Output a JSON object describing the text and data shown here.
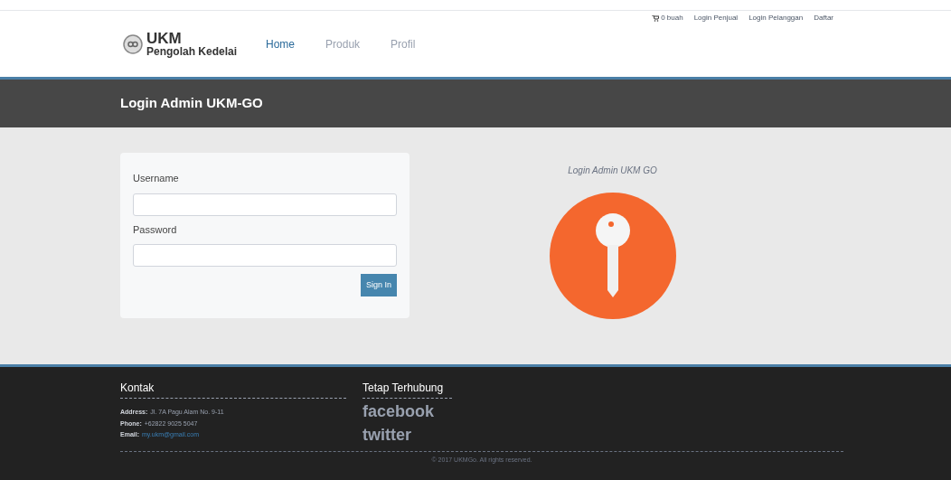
{
  "top_links": {
    "cart": "0 buah",
    "links": [
      "Login Penjual",
      "Login Pelanggan",
      "Daftar"
    ]
  },
  "brand": {
    "title": "UKM",
    "subtitle": "Pengolah Kedelai"
  },
  "nav": [
    {
      "label": "Home",
      "selected": true
    },
    {
      "label": "Produk",
      "selected": false
    },
    {
      "label": "Profil",
      "selected": false
    }
  ],
  "page_title": "Login Admin UKM-GO",
  "form": {
    "fields": [
      {
        "label": "Username"
      },
      {
        "label": "Password"
      }
    ],
    "submit": "Sign In"
  },
  "aside": {
    "caption": "Login Admin UKM GO"
  },
  "footer": {
    "contact_title": "Kontak",
    "contact": [
      {
        "label": "Address:",
        "value": "Jl. 7A Pagu Alam No. 9-11"
      },
      {
        "label": "Phone:",
        "value": "+62822 9025 5047"
      },
      {
        "label": "Email:",
        "value": "my.ukm@gmail.com"
      }
    ],
    "social_title": "Tetap Terhubung",
    "social": [
      "facebook",
      "twitter"
    ],
    "copyright": "© 2017 UKMGo. All rights reserved."
  }
}
